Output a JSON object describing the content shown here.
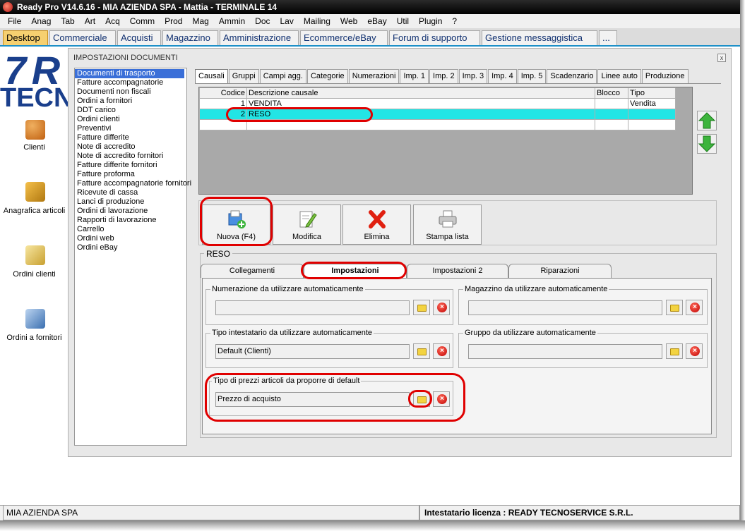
{
  "window": {
    "title": "Ready Pro V14.6.16 - MIA AZIENDA SPA - Mattia - TERMINALE 14"
  },
  "menu": [
    "File",
    "Anag",
    "Tab",
    "Art",
    "Acq",
    "Comm",
    "Prod",
    "Mag",
    "Ammin",
    "Doc",
    "Lav",
    "Mailing",
    "Web",
    "eBay",
    "Util",
    "Plugin",
    "?"
  ],
  "main_tabs": [
    "Desktop",
    "Commerciale",
    "Acquisti",
    "Magazzino",
    "Amministrazione",
    "Ecommerce/eBay",
    "Forum di supporto",
    "Gestione messaggistica",
    "..."
  ],
  "desktop": {
    "logo_top": "7 R",
    "logo_bottom": "TECN",
    "icons": [
      {
        "label": "Clienti",
        "icon": "clients-icon"
      },
      {
        "label": "Anagrafica articoli",
        "icon": "box-icon"
      },
      {
        "label": "Ordini clienti",
        "icon": "customer-orders-icon"
      },
      {
        "label": "Ordini a fornitori",
        "icon": "supplier-orders-icon"
      }
    ]
  },
  "panel": {
    "title": "IMPOSTAZIONI DOCUMENTI",
    "close": "x",
    "documents": [
      "Documenti di trasporto",
      "Fatture accompagnatorie",
      "Documenti non fiscali",
      "Ordini a fornitori",
      "DDT carico",
      "Ordini clienti",
      "Preventivi",
      "Fatture differite",
      "Note di accredito",
      "Note di accredito fornitori",
      "Fatture differite fornitori",
      "Fatture proforma",
      "Fatture accompagnatorie fornitori",
      "Ricevute di cassa",
      "Lanci di produzione",
      "Ordini di lavorazione",
      "Rapporti di lavorazione",
      "Carrello",
      "Ordini web",
      "Ordini eBay"
    ],
    "subtabs": [
      "Causali",
      "Gruppi",
      "Campi agg.",
      "Categorie",
      "Numerazioni",
      "Imp. 1",
      "Imp. 2",
      "Imp. 3",
      "Imp. 4",
      "Imp. 5",
      "Scadenzario",
      "Linee auto",
      "Produzione"
    ],
    "grid": {
      "headers": [
        "Codice",
        "Descrizione causale",
        "Blocco",
        "Tipo"
      ],
      "rows": [
        [
          "1",
          "VENDITA",
          "",
          "Vendita"
        ],
        [
          "2",
          "RESO",
          "",
          ""
        ],
        [
          "",
          "",
          "",
          ""
        ]
      ]
    },
    "toolbar": {
      "new": "Nuova (F4)",
      "edit": "Modifica",
      "delete": "Elimina",
      "print": "Stampa lista"
    },
    "group_title": "RESO",
    "lower_tabs": [
      "Collegamenti",
      "Impostazioni",
      "Impostazioni 2",
      "Riparazioni"
    ],
    "fields": {
      "numerazione": {
        "label": "Numerazione da utilizzare automaticamente",
        "value": ""
      },
      "magazzino": {
        "label": "Magazzino da utilizzare automaticamente",
        "value": ""
      },
      "intestatario": {
        "label": "Tipo intestatario da utilizzare automaticamente",
        "value": "Default (Clienti)"
      },
      "gruppo": {
        "label": "Gruppo da utilizzare automaticamente",
        "value": ""
      },
      "prezzi": {
        "label": "Tipo di prezzi articoli da proporre di default",
        "value": "Prezzo di acquisto"
      }
    }
  },
  "status": {
    "left": "MIA AZIENDA SPA",
    "right": "Intestatario licenza : READY TECNOSERVICE S.R.L."
  },
  "colors": {
    "selected_row": "#22e5e5",
    "highlight": "#e00000",
    "active_tab": "#f6d070"
  }
}
